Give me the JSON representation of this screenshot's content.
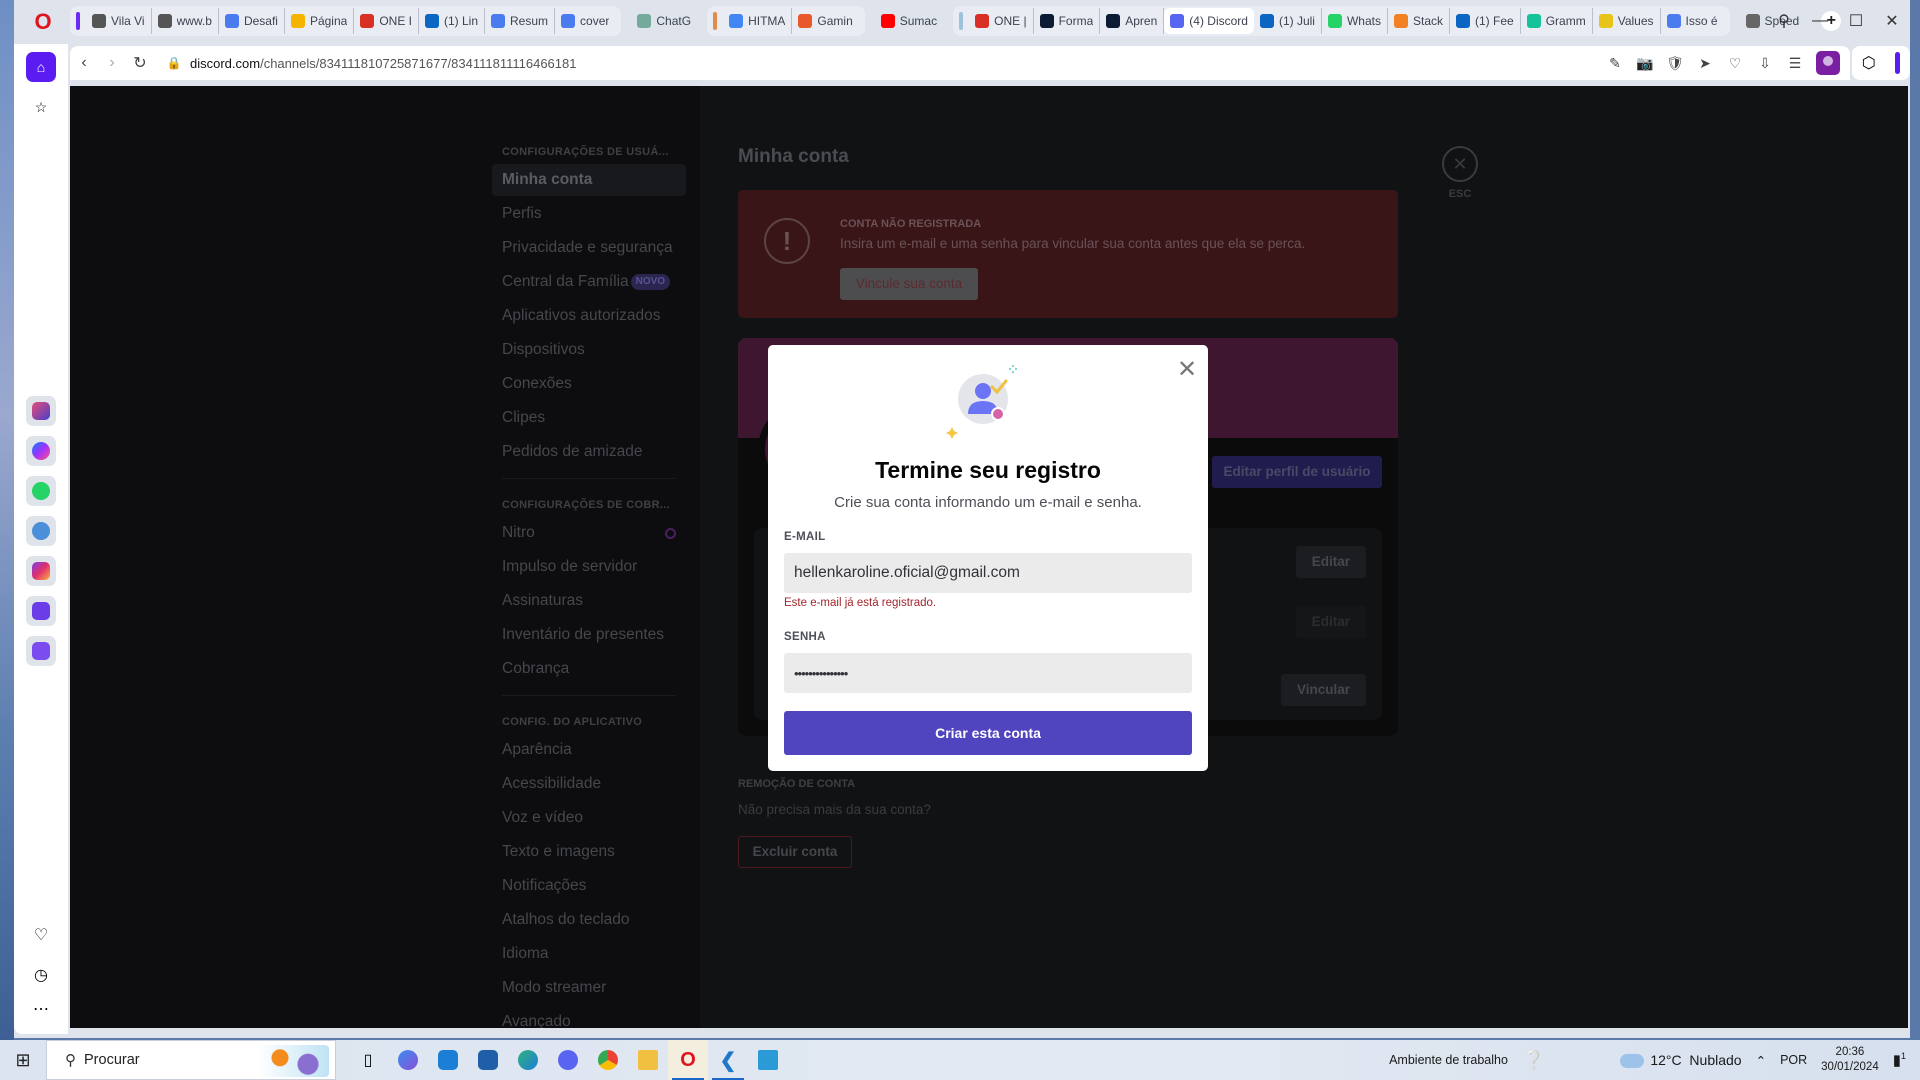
{
  "browser": {
    "tabs": [
      {
        "label": "Vila Vi",
        "favicon": "doc-icon",
        "color": "#555555"
      },
      {
        "label": "www.b",
        "favicon": "doc-icon",
        "color": "#555555"
      },
      {
        "label": "Desafi",
        "favicon": "google-docs-icon",
        "color": "#4a7cf0"
      },
      {
        "label": "Página",
        "favicon": "google-drive-icon",
        "color": "#f4b400"
      },
      {
        "label": "ONE I",
        "favicon": "gmail-icon",
        "color": "#d93025"
      },
      {
        "label": "(1) Lin",
        "favicon": "linkedin-icon",
        "color": "#0a66c2"
      },
      {
        "label": "Resum",
        "favicon": "google-docs-icon",
        "color": "#4a7cf0"
      },
      {
        "label": "cover",
        "favicon": "google-docs-icon",
        "color": "#4a7cf0"
      },
      {
        "label": "ChatG",
        "favicon": "chatgpt-icon",
        "color": "#74aa9c"
      },
      {
        "label": "HITMA",
        "favicon": "google-icon",
        "color": "#4285f4"
      },
      {
        "label": "Gamin",
        "favicon": "gaming-icon",
        "color": "#e8582a"
      },
      {
        "label": "Sumac",
        "favicon": "youtube-icon",
        "color": "#ff0000"
      },
      {
        "label": "ONE |",
        "favicon": "gmail-icon",
        "color": "#d93025"
      },
      {
        "label": "Forma",
        "favicon": "alura-icon",
        "color": "#0b1b33"
      },
      {
        "label": "Apren",
        "favicon": "alura-icon",
        "color": "#0b1b33"
      },
      {
        "label": "(4) Discord",
        "favicon": "discord-icon",
        "color": "#5865f2",
        "active": true
      },
      {
        "label": "(1) Juli",
        "favicon": "linkedin-icon",
        "color": "#0a66c2"
      },
      {
        "label": "Whats",
        "favicon": "whatsapp-icon",
        "color": "#25d366"
      },
      {
        "label": "Stack",
        "favicon": "stackoverflow-icon",
        "color": "#f48024"
      },
      {
        "label": "(1) Fee",
        "favicon": "linkedin-icon",
        "color": "#0a66c2"
      },
      {
        "label": "Gramm",
        "favicon": "grammarly-icon",
        "color": "#15c39a"
      },
      {
        "label": "Values",
        "favicon": "ejs-icon",
        "color": "#e8c31a"
      },
      {
        "label": "Isso é",
        "favicon": "google-docs-icon",
        "color": "#4a7cf0"
      },
      {
        "label": "Speed",
        "favicon": "speed-dial-icon",
        "color": "#666666"
      }
    ],
    "url_host": "discord.com",
    "url_path": "/channels/834111810725871677/834111811116466181"
  },
  "settings": {
    "sections": [
      {
        "header": "CONFIGURAÇÕES DE USUÁ...",
        "items": [
          {
            "label": "Minha conta",
            "active": true
          },
          {
            "label": "Perfis"
          },
          {
            "label": "Privacidade e segurança"
          },
          {
            "label": "Central da Família",
            "badge": "NOVO"
          },
          {
            "label": "Aplicativos autorizados"
          },
          {
            "label": "Dispositivos"
          },
          {
            "label": "Conexões"
          },
          {
            "label": "Clipes"
          },
          {
            "label": "Pedidos de amizade"
          }
        ]
      },
      {
        "header": "CONFIGURAÇÕES DE COBR...",
        "items": [
          {
            "label": "Nitro",
            "icon": "nitro-icon"
          },
          {
            "label": "Impulso de servidor"
          },
          {
            "label": "Assinaturas"
          },
          {
            "label": "Inventário de presentes"
          },
          {
            "label": "Cobrança"
          }
        ]
      },
      {
        "header": "CONFIG. DO APLICATIVO",
        "items": [
          {
            "label": "Aparência"
          },
          {
            "label": "Acessibilidade"
          },
          {
            "label": "Voz e vídeo"
          },
          {
            "label": "Texto e imagens"
          },
          {
            "label": "Notificações"
          },
          {
            "label": "Atalhos do teclado"
          },
          {
            "label": "Idioma"
          },
          {
            "label": "Modo streamer"
          },
          {
            "label": "Avançado"
          }
        ]
      }
    ]
  },
  "main": {
    "title": "Minha conta",
    "warning": {
      "title": "CONTA NÃO REGISTRADA",
      "text": "Insira um e-mail e uma senha para vincular sua conta antes que ela se perca.",
      "button": "Vincule sua conta"
    },
    "profile": {
      "edit_button": "Editar perfil de usuário",
      "field_buttons": [
        "Editar",
        "Editar",
        "Vincular"
      ]
    },
    "removal": {
      "title": "REMOÇÃO DE CONTA",
      "text": "Não precisa mais da sua conta?",
      "button": "Excluir conta"
    },
    "esc_label": "ESC"
  },
  "modal": {
    "title": "Termine seu registro",
    "subtitle": "Crie sua conta informando um e-mail e senha.",
    "email_label": "E-MAIL",
    "email_value": "hellenkaroline.oficial@gmail.com",
    "email_error": "Este e-mail já está registrado.",
    "password_label": "SENHA",
    "password_value": "•••••••••••••••",
    "submit": "Criar esta conta"
  },
  "taskbar": {
    "search_placeholder": "Procurar",
    "toolbar_label": "Ambiente de trabalho",
    "weather_temp": "12°C",
    "weather_desc": "Nublado",
    "language": "POR",
    "time": "20:36",
    "date": "30/01/2024",
    "notifications_count": "1"
  }
}
